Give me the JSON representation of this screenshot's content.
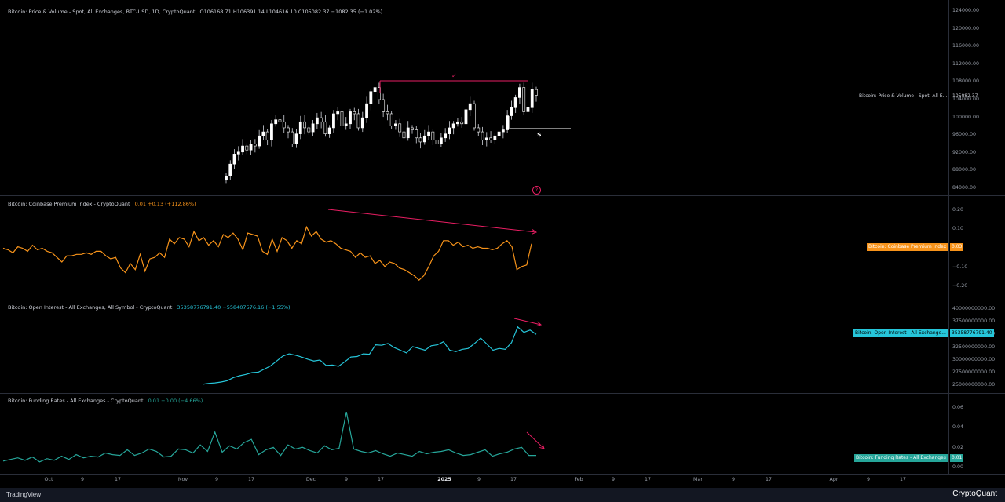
{
  "colors": {
    "bg": "#000000",
    "up": "#ffffff",
    "down": "#000000",
    "cpi": "#f7931a",
    "oi": "#26c6da",
    "fr": "#26a69a",
    "annot": "#e91e63",
    "grid": "#2a2e39"
  },
  "legends": {
    "price": {
      "title": "Bitcoin: Price & Volume - Spot, All Exchanges, BTC-USD, 1D, CryptoQuant",
      "o": "O106168.71",
      "h": "H106391.14",
      "l": "L104616.10",
      "c": "C105082.37",
      "chg": "−1082.35 (−1.02%)"
    },
    "cpi": {
      "title": "Bitcoin: Coinbase Premium Index - CryptoQuant",
      "v": "0.01",
      "chg": "+0.13 (+112.86%)"
    },
    "oi": {
      "title": "Bitcoin: Open Interest - All Exchanges, All Symbol - CryptoQuant",
      "v": "35358776791.40",
      "chg": "−558407576.16 (−1.55%)"
    },
    "fr": {
      "title": "Bitcoin: Funding Rates - All Exchanges - CryptoQuant",
      "v": "0.01",
      "chg": "−0.00 (−4.66%)"
    }
  },
  "tags": {
    "price_name": "Bitcoin: Price & Volume - Spot, All E...",
    "price_val": "105082.37",
    "cpi_name": "Bitcoin: Coinbase Premium Index",
    "cpi_val": "0.03",
    "oi_name": "Bitcoin: Open Interest - All Exchange...",
    "oi_val": "35358776791.40",
    "fr_name": "Bitcoin: Funding Rates - All Exchanges",
    "fr_val": "0.01"
  },
  "annotations": {
    "check": "✓",
    "dollar": "$",
    "question": "?"
  },
  "footer": {
    "left": "TradingView",
    "right": "CryptoQuant"
  },
  "chart_data": [
    {
      "type": "candlestick",
      "name": "Bitcoin: Price & Volume - Spot, All Exchanges, BTC-USD, 1D",
      "ylim": [
        82000,
        126000
      ],
      "yticks": [
        "124000.00",
        "120000.00",
        "116000.00",
        "112000.00",
        "108000.00",
        "104000.00",
        "100000.00",
        "96000.00",
        "92000.00",
        "88000.00",
        "84000.00"
      ],
      "xticks": [
        "Oct",
        "9",
        "17",
        "Nov",
        "9",
        "17",
        "Dec",
        "9",
        "17",
        "2025",
        "9",
        "17",
        "Feb",
        "9",
        "17",
        "Mar",
        "9",
        "17",
        "Apr",
        "9",
        "17"
      ],
      "close": [
        85000,
        88000,
        90500,
        91000,
        92500,
        91500,
        93000,
        92500,
        95000,
        96000,
        94000,
        98000,
        99000,
        98500,
        97000,
        96000,
        93000,
        95500,
        98500,
        97000,
        96000,
        98000,
        99500,
        98500,
        95500,
        97000,
        100500,
        101000,
        97500,
        98000,
        101000,
        100500,
        97000,
        99500,
        103000,
        106000,
        107000,
        104000,
        101000,
        100500,
        97500,
        98000,
        96000,
        94500,
        97000,
        96500,
        94500,
        93500,
        95000,
        96000,
        94000,
        93000,
        94500,
        95500,
        97000,
        98000,
        98500,
        98000,
        101500,
        103000,
        97000,
        96000,
        94000,
        94500,
        94000,
        95000,
        96000,
        96500,
        100000,
        102000,
        104500,
        107000,
        101000,
        102000,
        106500,
        105082
      ]
    },
    {
      "type": "line",
      "name": "Bitcoin: Coinbase Premium Index",
      "ylim": [
        -0.25,
        0.25
      ],
      "yticks": [
        "0.20",
        "0.10",
        "0.00",
        "−0.10",
        "−0.20"
      ],
      "values": [
        0.0,
        -0.01,
        -0.03,
        0.01,
        0.0,
        -0.02,
        0.02,
        -0.01,
        0.0,
        -0.02,
        -0.03,
        -0.06,
        -0.09,
        -0.05,
        -0.05,
        -0.04,
        -0.04,
        -0.03,
        -0.04,
        -0.02,
        -0.02,
        -0.05,
        -0.07,
        -0.06,
        -0.13,
        -0.16,
        -0.1,
        -0.14,
        -0.04,
        -0.15,
        -0.07,
        -0.06,
        -0.03,
        -0.06,
        0.06,
        0.03,
        0.07,
        0.06,
        0.01,
        0.11,
        0.05,
        0.07,
        0.02,
        0.05,
        0.01,
        0.09,
        0.07,
        0.1,
        0.06,
        -0.01,
        0.1,
        0.09,
        0.08,
        -0.02,
        -0.04,
        0.06,
        -0.02,
        0.07,
        0.05,
        0.0,
        0.05,
        0.03,
        0.14,
        0.08,
        0.11,
        0.06,
        0.04,
        0.05,
        0.03,
        0.0,
        -0.01,
        -0.02,
        -0.06,
        -0.03,
        -0.06,
        -0.05,
        -0.1,
        -0.08,
        -0.12,
        -0.09,
        -0.1,
        -0.13,
        -0.14,
        -0.16,
        -0.18,
        -0.21,
        -0.18,
        -0.12,
        -0.05,
        -0.02,
        0.05,
        0.05,
        0.02,
        0.04,
        0.01,
        0.02,
        0.0,
        0.01,
        0.0,
        0.0,
        -0.01,
        0.0,
        0.03,
        0.05,
        0.01,
        -0.14,
        -0.12,
        -0.11,
        0.03
      ]
    },
    {
      "type": "line",
      "name": "Bitcoin: Open Interest - All Exchanges, All Symbol",
      "ylim": [
        24000000000,
        41000000000
      ],
      "yticks": [
        "40000000000.00",
        "37500000000.00",
        "35000000000.00",
        "32500000000.00",
        "30000000000.00",
        "27500000000.00",
        "25000000000.00"
      ],
      "values": [
        24200000000,
        24400000000,
        24500000000,
        24700000000,
        25000000000,
        25700000000,
        26100000000,
        26400000000,
        26800000000,
        26900000000,
        27600000000,
        28300000000,
        29400000000,
        30500000000,
        31000000000,
        30700000000,
        30300000000,
        29800000000,
        29400000000,
        29600000000,
        28400000000,
        28500000000,
        28200000000,
        29200000000,
        30300000000,
        30400000000,
        31000000000,
        30900000000,
        33000000000,
        32900000000,
        33300000000,
        32400000000,
        31800000000,
        31200000000,
        32600000000,
        32200000000,
        31800000000,
        32800000000,
        33000000000,
        33700000000,
        31800000000,
        31500000000,
        32000000000,
        32200000000,
        33300000000,
        34500000000,
        33200000000,
        31800000000,
        32200000000,
        32000000000,
        33500000000,
        37000000000,
        35800000000,
        36300000000,
        35359000000
      ]
    },
    {
      "type": "line",
      "name": "Bitcoin: Funding Rates - All Exchanges",
      "ylim": [
        -0.004,
        0.07
      ],
      "yticks": [
        "0.06",
        "0.04",
        "0.02",
        "0.00"
      ],
      "values": [
        0.004,
        0.006,
        0.008,
        0.005,
        0.009,
        0.003,
        0.007,
        0.005,
        0.01,
        0.006,
        0.012,
        0.008,
        0.01,
        0.009,
        0.014,
        0.012,
        0.011,
        0.018,
        0.011,
        0.014,
        0.019,
        0.016,
        0.009,
        0.01,
        0.019,
        0.018,
        0.014,
        0.024,
        0.016,
        0.04,
        0.015,
        0.023,
        0.019,
        0.027,
        0.031,
        0.012,
        0.018,
        0.021,
        0.011,
        0.024,
        0.019,
        0.021,
        0.017,
        0.014,
        0.023,
        0.018,
        0.02,
        0.065,
        0.019,
        0.016,
        0.014,
        0.017,
        0.013,
        0.01,
        0.014,
        0.012,
        0.01,
        0.016,
        0.013,
        0.015,
        0.016,
        0.018,
        0.014,
        0.011,
        0.012,
        0.015,
        0.018,
        0.01,
        0.013,
        0.015,
        0.019,
        0.021,
        0.011,
        0.011
      ]
    }
  ]
}
